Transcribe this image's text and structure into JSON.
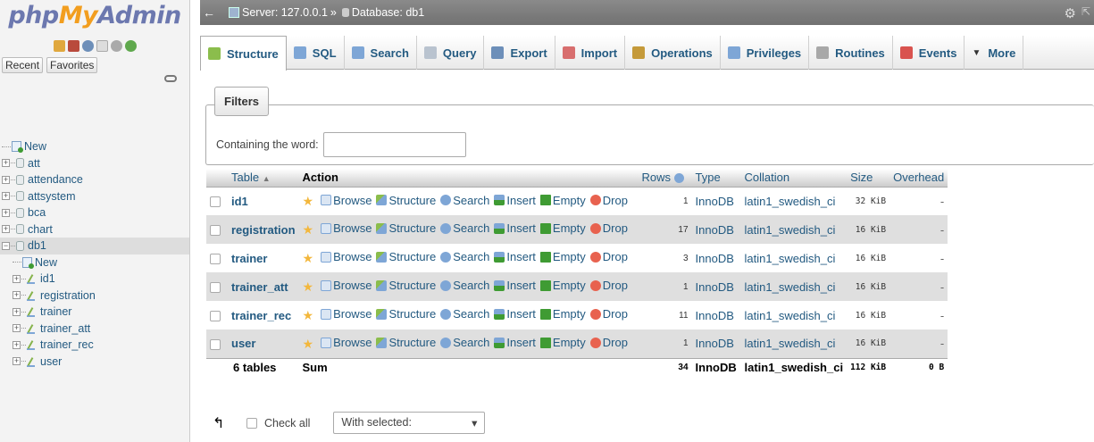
{
  "sidebar": {
    "logo": {
      "part1": "php",
      "part2": "My",
      "part3": "Admin"
    },
    "nav_icons": [
      "home-icon",
      "logout-icon",
      "help-icon",
      "docs-icon",
      "settings-icon",
      "reload-icon"
    ],
    "recent_label": "Recent",
    "favorites_label": "Favorites",
    "tree": [
      {
        "label": "New",
        "type": "new",
        "level": 0
      },
      {
        "label": "att",
        "type": "db",
        "level": 0
      },
      {
        "label": "attendance",
        "type": "db",
        "level": 0
      },
      {
        "label": "attsystem",
        "type": "db",
        "level": 0
      },
      {
        "label": "bca",
        "type": "db",
        "level": 0
      },
      {
        "label": "chart",
        "type": "db",
        "level": 0
      },
      {
        "label": "db1",
        "type": "db",
        "level": 0,
        "expanded": true
      },
      {
        "label": "New",
        "type": "new",
        "level": 1
      },
      {
        "label": "id1",
        "type": "table",
        "level": 1
      },
      {
        "label": "registration",
        "type": "table",
        "level": 1
      },
      {
        "label": "trainer",
        "type": "table",
        "level": 1
      },
      {
        "label": "trainer_att",
        "type": "table",
        "level": 1
      },
      {
        "label": "trainer_rec",
        "type": "table",
        "level": 1
      },
      {
        "label": "user",
        "type": "table",
        "level": 1
      }
    ]
  },
  "topbar": {
    "server": "Server: 127.0.0.1",
    "sep": "»",
    "database": "Database: db1"
  },
  "tabs": [
    {
      "label": "Structure",
      "icon": "structure-icon",
      "color": "#8bbd4c",
      "active": true
    },
    {
      "label": "SQL",
      "icon": "sql-icon",
      "color": "#7ea6d6"
    },
    {
      "label": "Search",
      "icon": "search-icon",
      "color": "#7ea6d6"
    },
    {
      "label": "Query",
      "icon": "query-icon",
      "color": "#b9c3cf"
    },
    {
      "label": "Export",
      "icon": "export-icon",
      "color": "#6d8fb9"
    },
    {
      "label": "Import",
      "icon": "import-icon",
      "color": "#d86e6e"
    },
    {
      "label": "Operations",
      "icon": "wrench-icon",
      "color": "#c59a3a"
    },
    {
      "label": "Privileges",
      "icon": "privileges-icon",
      "color": "#7ea6d6"
    },
    {
      "label": "Routines",
      "icon": "routines-icon",
      "color": "#a8a8a8"
    },
    {
      "label": "Events",
      "icon": "clock-icon",
      "color": "#d9534f"
    },
    {
      "label": "More",
      "icon": "triangle-down-icon",
      "color": "#333"
    }
  ],
  "filters": {
    "legend": "Filters",
    "containing_label": "Containing the word:",
    "input_value": ""
  },
  "table": {
    "headers": {
      "table": "Table",
      "sort": "▲",
      "action": "Action",
      "rows": "Rows",
      "type": "Type",
      "collation": "Collation",
      "size": "Size",
      "overhead": "Overhead"
    },
    "actions": [
      "Browse",
      "Structure",
      "Search",
      "Insert",
      "Empty",
      "Drop"
    ],
    "rows": [
      {
        "name": "id1",
        "rows": "1",
        "type": "InnoDB",
        "collation": "latin1_swedish_ci",
        "size": "32 KiB",
        "overhead": "-"
      },
      {
        "name": "registration",
        "rows": "17",
        "type": "InnoDB",
        "collation": "latin1_swedish_ci",
        "size": "16 KiB",
        "overhead": "-"
      },
      {
        "name": "trainer",
        "rows": "3",
        "type": "InnoDB",
        "collation": "latin1_swedish_ci",
        "size": "16 KiB",
        "overhead": "-"
      },
      {
        "name": "trainer_att",
        "rows": "1",
        "type": "InnoDB",
        "collation": "latin1_swedish_ci",
        "size": "16 KiB",
        "overhead": "-"
      },
      {
        "name": "trainer_rec",
        "rows": "11",
        "type": "InnoDB",
        "collation": "latin1_swedish_ci",
        "size": "16 KiB",
        "overhead": "-"
      },
      {
        "name": "user",
        "rows": "1",
        "type": "InnoDB",
        "collation": "latin1_swedish_ci",
        "size": "16 KiB",
        "overhead": "-"
      }
    ],
    "footer": {
      "count": "6 tables",
      "sum": "Sum",
      "rows": "34",
      "type": "InnoDB",
      "collation": "latin1_swedish_ci",
      "size": "112 KiB",
      "overhead": "0 B"
    }
  },
  "bottom": {
    "check_all": "Check all",
    "with_selected": "With selected:",
    "dropdown_arrow": "▾"
  }
}
